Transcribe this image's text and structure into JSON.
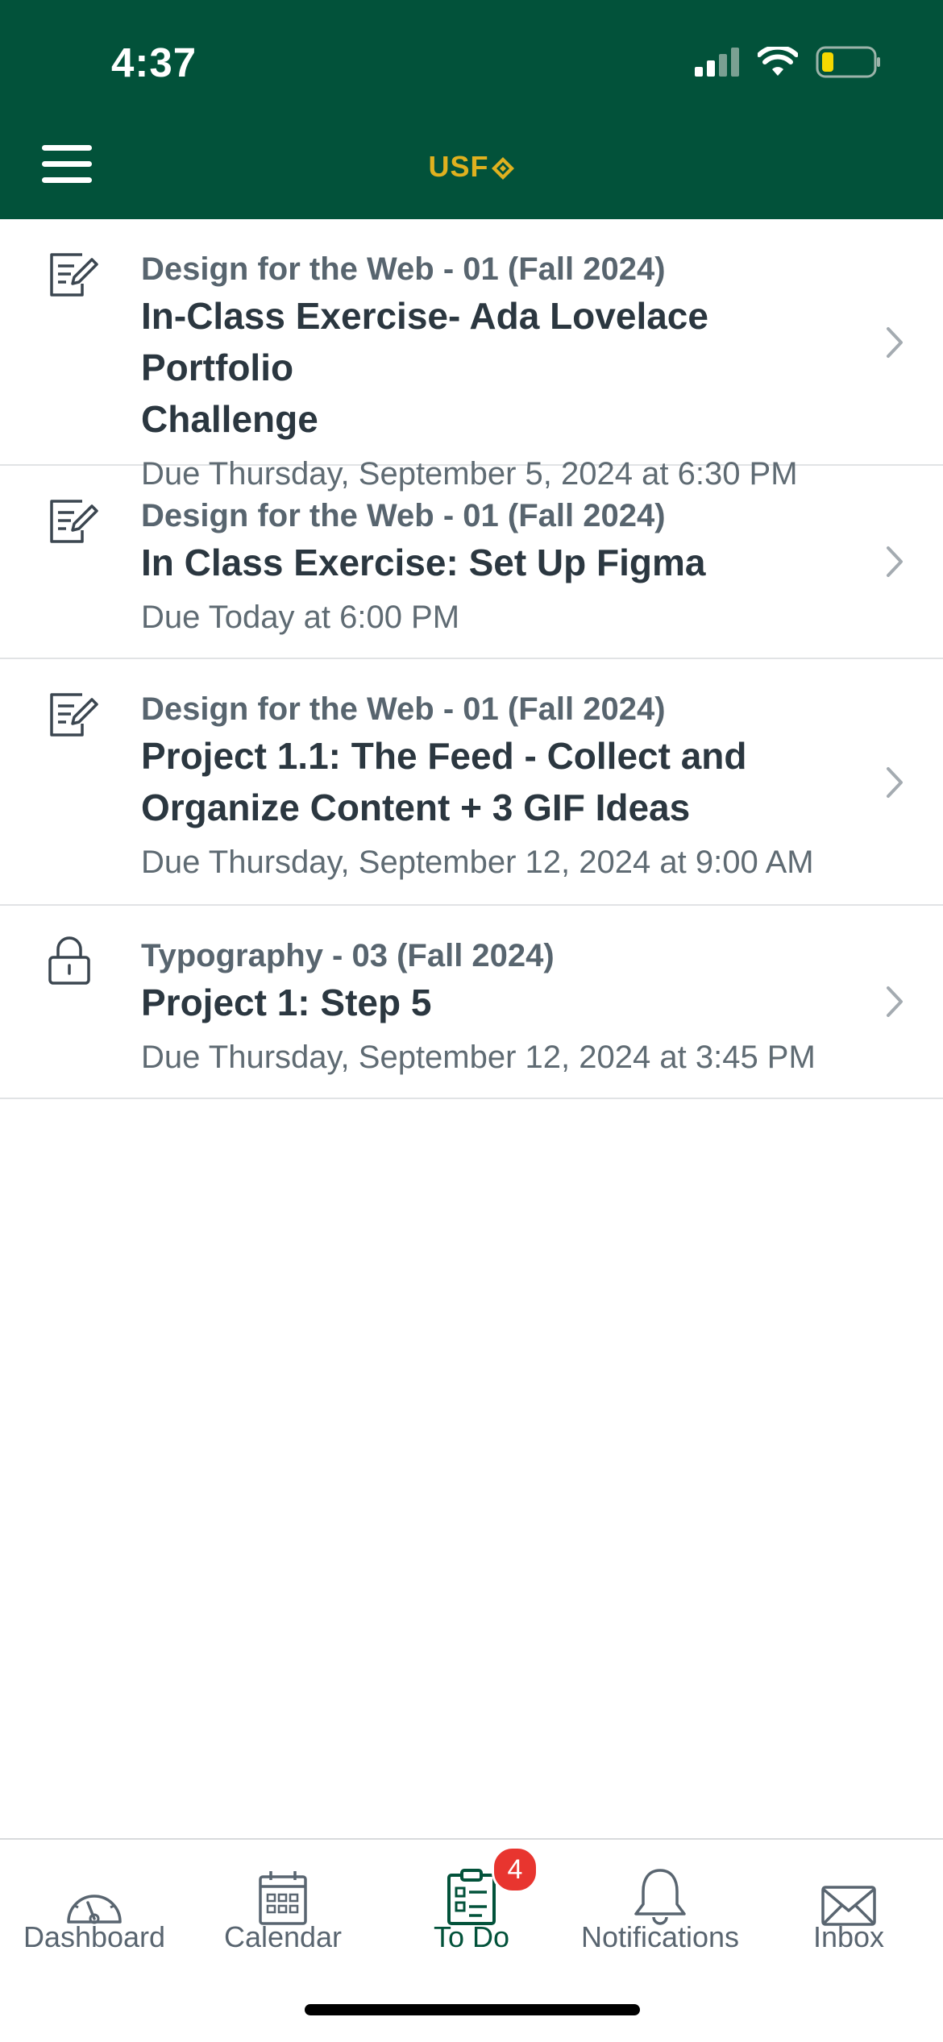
{
  "status_bar": {
    "time": "4:37"
  },
  "header": {
    "brand": "USF"
  },
  "todo_items": [
    {
      "course": "Design for the Web - 01 (Fall 2024)",
      "title_lines": [
        "In-Class Exercise- Ada Lovelace Portfolio",
        "Challenge"
      ],
      "due": "Due Thursday, September 5, 2024 at 6:30 PM",
      "icon": "assignment-icon"
    },
    {
      "course": "Design for the Web - 01 (Fall 2024)",
      "title_lines": [
        "In Class Exercise: Set Up Figma"
      ],
      "due": "Due Today at 6:00 PM",
      "icon": "assignment-icon"
    },
    {
      "course": "Design for the Web - 01 (Fall 2024)",
      "title_lines": [
        "Project 1.1: The Feed - Collect and",
        "Organize Content + 3 GIF Ideas"
      ],
      "due": "Due Thursday, September 12, 2024 at 9:00 AM",
      "icon": "assignment-icon"
    },
    {
      "course": "Typography - 03 (Fall 2024)",
      "title_lines": [
        "Project 1: Step 5"
      ],
      "due": "Due Thursday, September 12, 2024 at 3:45 PM",
      "icon": "lock-icon"
    }
  ],
  "tabbar": {
    "tabs": [
      {
        "label": "Dashboard",
        "icon": "dashboard-icon"
      },
      {
        "label": "Calendar",
        "icon": "calendar-icon"
      },
      {
        "label": "To Do",
        "icon": "todo-icon",
        "active": true
      },
      {
        "label": "Notifications",
        "icon": "bell-icon"
      },
      {
        "label": "Inbox",
        "icon": "inbox-icon"
      }
    ],
    "todo_badge": "4"
  },
  "colors": {
    "header_bg": "#02523a",
    "brand_gold": "#e0b11f",
    "active_tab": "#02523a",
    "badge": "#e8352f"
  }
}
